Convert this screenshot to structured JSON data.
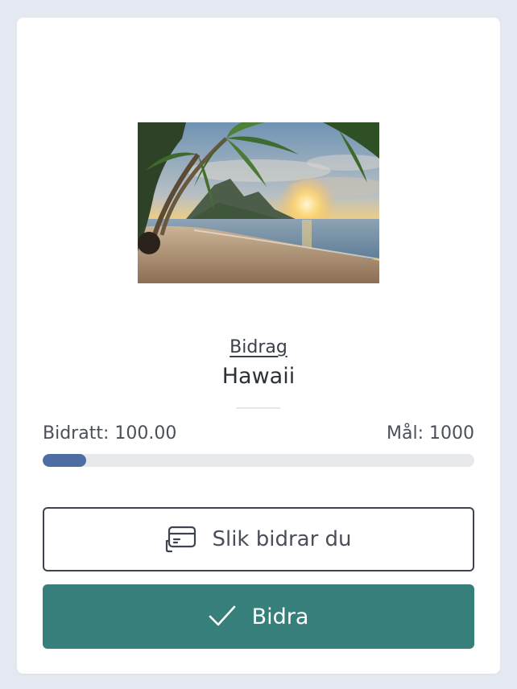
{
  "campaign": {
    "heading_link": "Bidrag",
    "title": "Hawaii",
    "contributed_label": "Bidratt: 100.00",
    "goal_label": "Mål: 1000",
    "progress_fraction": 0.1
  },
  "actions": {
    "how_to_label": "Slik bidrar du",
    "how_to_icon": "credit-card-icon",
    "contribute_label": "Bidra",
    "contribute_icon": "check-icon"
  },
  "colors": {
    "progress_fill": "#4d6ea3",
    "primary_button": "#377f7b",
    "background": "#e4e8f0"
  }
}
